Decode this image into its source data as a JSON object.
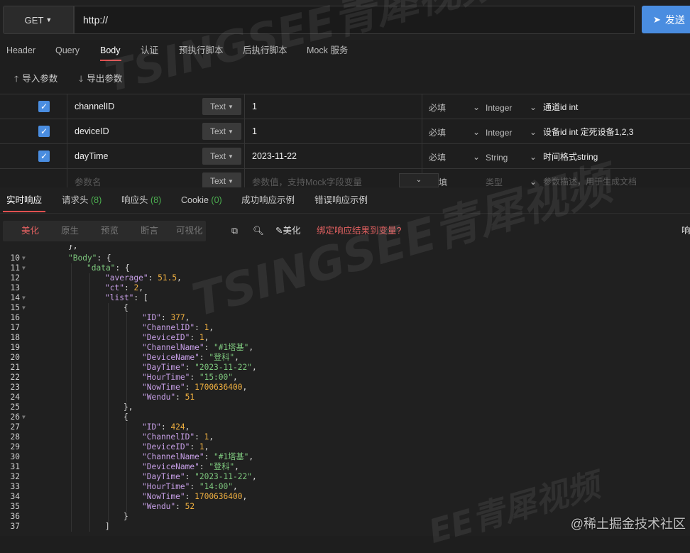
{
  "request": {
    "method": "GET",
    "url": "http://",
    "send_label": "发送"
  },
  "tabs": [
    "Header",
    "Query",
    "Body",
    "认证",
    "预执行脚本",
    "后执行脚本",
    "Mock 服务"
  ],
  "active_tab": "Body",
  "tools": {
    "import_label": "导入参数",
    "export_label": "导出参数"
  },
  "params": [
    {
      "checked": true,
      "name": "channelID",
      "type": "Text",
      "value": "1",
      "required": "必填",
      "datatype": "Integer",
      "desc": "通道id int"
    },
    {
      "checked": true,
      "name": "deviceID",
      "type": "Text",
      "value": "1",
      "required": "必填",
      "datatype": "Integer",
      "desc": "设备id int  定死设备1,2,3"
    },
    {
      "checked": true,
      "name": "dayTime",
      "type": "Text",
      "value": "2023-11-22",
      "required": "必填",
      "datatype": "String",
      "desc": "时间格式string"
    }
  ],
  "new_row": {
    "name_placeholder": "参数名",
    "type": "Text",
    "value_placeholder": "参数值，支持Mock字段变量",
    "required": "填",
    "datatype_placeholder": "类型",
    "desc_placeholder": "参数描述，用于生成文档"
  },
  "response_tabs": {
    "realtime": "实时响应",
    "req_headers": "请求头",
    "req_headers_count": "(8)",
    "resp_headers": "响应头",
    "resp_headers_count": "(8)",
    "cookie": "Cookie",
    "cookie_count": "(0)",
    "success_example": "成功响应示例",
    "error_example": "错误响应示例"
  },
  "view_modes": [
    "美化",
    "原生",
    "预览",
    "断言",
    "可视化"
  ],
  "active_view": "美化",
  "actions": {
    "beautify_label": "美化",
    "bind_var_label": "绑定响应结果到变量?",
    "cut_label": "响"
  },
  "code_lines": [
    {
      "n": "10",
      "fold": true,
      "indent": 1,
      "tokens": [
        [
          "s_key",
          "\"Body\""
        ],
        [
          "p",
          ": {"
        ]
      ]
    },
    {
      "n": "11",
      "fold": true,
      "indent": 2,
      "tokens": [
        [
          "s_key",
          "\"data\""
        ],
        [
          "p",
          ": {"
        ]
      ]
    },
    {
      "n": "12",
      "fold": false,
      "indent": 3,
      "tokens": [
        [
          "k",
          "\"average\""
        ],
        [
          "p",
          ": "
        ],
        [
          "n",
          "51.5"
        ],
        [
          "p",
          ","
        ]
      ]
    },
    {
      "n": "13",
      "fold": false,
      "indent": 3,
      "tokens": [
        [
          "k",
          "\"ct\""
        ],
        [
          "p",
          ": "
        ],
        [
          "n",
          "2"
        ],
        [
          "p",
          ","
        ]
      ]
    },
    {
      "n": "14",
      "fold": true,
      "indent": 3,
      "tokens": [
        [
          "k",
          "\"list\""
        ],
        [
          "p",
          ": ["
        ]
      ]
    },
    {
      "n": "15",
      "fold": true,
      "indent": 4,
      "tokens": [
        [
          "p",
          "{"
        ]
      ]
    },
    {
      "n": "16",
      "fold": false,
      "indent": 5,
      "tokens": [
        [
          "k",
          "\"ID\""
        ],
        [
          "p",
          ": "
        ],
        [
          "n",
          "377"
        ],
        [
          "p",
          ","
        ]
      ]
    },
    {
      "n": "17",
      "fold": false,
      "indent": 5,
      "tokens": [
        [
          "k",
          "\"ChannelID\""
        ],
        [
          "p",
          ": "
        ],
        [
          "n",
          "1"
        ],
        [
          "p",
          ","
        ]
      ]
    },
    {
      "n": "18",
      "fold": false,
      "indent": 5,
      "tokens": [
        [
          "k",
          "\"DeviceID\""
        ],
        [
          "p",
          ": "
        ],
        [
          "n",
          "1"
        ],
        [
          "p",
          ","
        ]
      ]
    },
    {
      "n": "19",
      "fold": false,
      "indent": 5,
      "tokens": [
        [
          "k",
          "\"ChannelName\""
        ],
        [
          "p",
          ": "
        ],
        [
          "s",
          "\"#1塔基\""
        ],
        [
          "p",
          ","
        ]
      ]
    },
    {
      "n": "20",
      "fold": false,
      "indent": 5,
      "tokens": [
        [
          "k",
          "\"DeviceName\""
        ],
        [
          "p",
          ": "
        ],
        [
          "s",
          "\"登科\""
        ],
        [
          "p",
          ","
        ]
      ]
    },
    {
      "n": "21",
      "fold": false,
      "indent": 5,
      "tokens": [
        [
          "k",
          "\"DayTime\""
        ],
        [
          "p",
          ": "
        ],
        [
          "s",
          "\"2023-11-22\""
        ],
        [
          "p",
          ","
        ]
      ]
    },
    {
      "n": "22",
      "fold": false,
      "indent": 5,
      "tokens": [
        [
          "k",
          "\"HourTime\""
        ],
        [
          "p",
          ": "
        ],
        [
          "s",
          "\"15:00\""
        ],
        [
          "p",
          ","
        ]
      ]
    },
    {
      "n": "23",
      "fold": false,
      "indent": 5,
      "tokens": [
        [
          "k",
          "\"NowTime\""
        ],
        [
          "p",
          ": "
        ],
        [
          "n",
          "1700636400"
        ],
        [
          "p",
          ","
        ]
      ]
    },
    {
      "n": "24",
      "fold": false,
      "indent": 5,
      "tokens": [
        [
          "k",
          "\"Wendu\""
        ],
        [
          "p",
          ": "
        ],
        [
          "n",
          "51"
        ]
      ]
    },
    {
      "n": "25",
      "fold": false,
      "indent": 4,
      "tokens": [
        [
          "p",
          "},"
        ]
      ]
    },
    {
      "n": "26",
      "fold": true,
      "indent": 4,
      "tokens": [
        [
          "p",
          "{"
        ]
      ]
    },
    {
      "n": "27",
      "fold": false,
      "indent": 5,
      "tokens": [
        [
          "k",
          "\"ID\""
        ],
        [
          "p",
          ": "
        ],
        [
          "n",
          "424"
        ],
        [
          "p",
          ","
        ]
      ]
    },
    {
      "n": "28",
      "fold": false,
      "indent": 5,
      "tokens": [
        [
          "k",
          "\"ChannelID\""
        ],
        [
          "p",
          ": "
        ],
        [
          "n",
          "1"
        ],
        [
          "p",
          ","
        ]
      ]
    },
    {
      "n": "29",
      "fold": false,
      "indent": 5,
      "tokens": [
        [
          "k",
          "\"DeviceID\""
        ],
        [
          "p",
          ": "
        ],
        [
          "n",
          "1"
        ],
        [
          "p",
          ","
        ]
      ]
    },
    {
      "n": "30",
      "fold": false,
      "indent": 5,
      "tokens": [
        [
          "k",
          "\"ChannelName\""
        ],
        [
          "p",
          ": "
        ],
        [
          "s",
          "\"#1塔基\""
        ],
        [
          "p",
          ","
        ]
      ]
    },
    {
      "n": "31",
      "fold": false,
      "indent": 5,
      "tokens": [
        [
          "k",
          "\"DeviceName\""
        ],
        [
          "p",
          ": "
        ],
        [
          "s",
          "\"登科\""
        ],
        [
          "p",
          ","
        ]
      ]
    },
    {
      "n": "32",
      "fold": false,
      "indent": 5,
      "tokens": [
        [
          "k",
          "\"DayTime\""
        ],
        [
          "p",
          ": "
        ],
        [
          "s",
          "\"2023-11-22\""
        ],
        [
          "p",
          ","
        ]
      ]
    },
    {
      "n": "33",
      "fold": false,
      "indent": 5,
      "tokens": [
        [
          "k",
          "\"HourTime\""
        ],
        [
          "p",
          ": "
        ],
        [
          "s",
          "\"14:00\""
        ],
        [
          "p",
          ","
        ]
      ]
    },
    {
      "n": "34",
      "fold": false,
      "indent": 5,
      "tokens": [
        [
          "k",
          "\"NowTime\""
        ],
        [
          "p",
          ": "
        ],
        [
          "n",
          "1700636400"
        ],
        [
          "p",
          ","
        ]
      ]
    },
    {
      "n": "35",
      "fold": false,
      "indent": 5,
      "tokens": [
        [
          "k",
          "\"Wendu\""
        ],
        [
          "p",
          ": "
        ],
        [
          "n",
          "52"
        ]
      ]
    },
    {
      "n": "36",
      "fold": false,
      "indent": 4,
      "tokens": [
        [
          "p",
          "}"
        ]
      ]
    },
    {
      "n": "37",
      "fold": false,
      "indent": 3,
      "tokens": [
        [
          "p",
          "]"
        ]
      ]
    }
  ],
  "watermarks": [
    "TSINGSEE青犀视频",
    "TSINGSEE青犀视频",
    "EE青犀视频"
  ],
  "credit": "@稀土掘金技术社区"
}
